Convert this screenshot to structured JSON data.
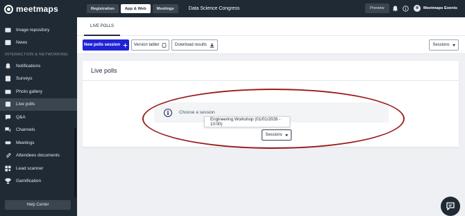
{
  "app": {
    "logo_text": "meetmaps"
  },
  "sidebar": {
    "items_top": [
      {
        "label": "Image repository",
        "icon": "image-icon"
      },
      {
        "label": "News",
        "icon": "news-icon"
      }
    ],
    "section_label": "INTERACTION & NETWORKING",
    "items": [
      {
        "label": "Notifications",
        "icon": "bell-icon"
      },
      {
        "label": "Surveys",
        "icon": "survey-icon"
      },
      {
        "label": "Photo gallery",
        "icon": "photo-icon"
      },
      {
        "label": "Live polls",
        "icon": "poll-icon",
        "active": true
      },
      {
        "label": "Q&A",
        "icon": "chat-icon"
      },
      {
        "label": "Channels",
        "icon": "channels-icon"
      },
      {
        "label": "Meetings",
        "icon": "handshake-icon"
      },
      {
        "label": "Attendees documents",
        "icon": "attachment-icon"
      },
      {
        "label": "Lead scanner",
        "icon": "qr-icon"
      },
      {
        "label": "Gamification",
        "icon": "trophy-icon"
      }
    ],
    "help_label": "Help Center"
  },
  "topbar": {
    "tabs": [
      {
        "label": "Registration"
      },
      {
        "label": "App & Web",
        "active": true
      },
      {
        "label": "Meetings"
      }
    ],
    "event_title": "Data Science Congress",
    "preview_label": "Preview",
    "account_name": "Meetmaps Events"
  },
  "main": {
    "tab_label": "LIVE POLLS",
    "toolbar": {
      "new_session_label": "New polls session",
      "tablet_label": "Version tablet",
      "download_label": "Download results",
      "sessions_label": "Sessions"
    },
    "card": {
      "title": "Live polls",
      "info_text": "Choose a session",
      "dropdown_option": "Engineering Workshop (01/01/2026 - 10:00)",
      "sessions_label": "Sessions"
    }
  },
  "colors": {
    "sidebar_bg": "#1f2a35",
    "primary": "#1f23d6",
    "annotation": "#9b1c1c"
  }
}
